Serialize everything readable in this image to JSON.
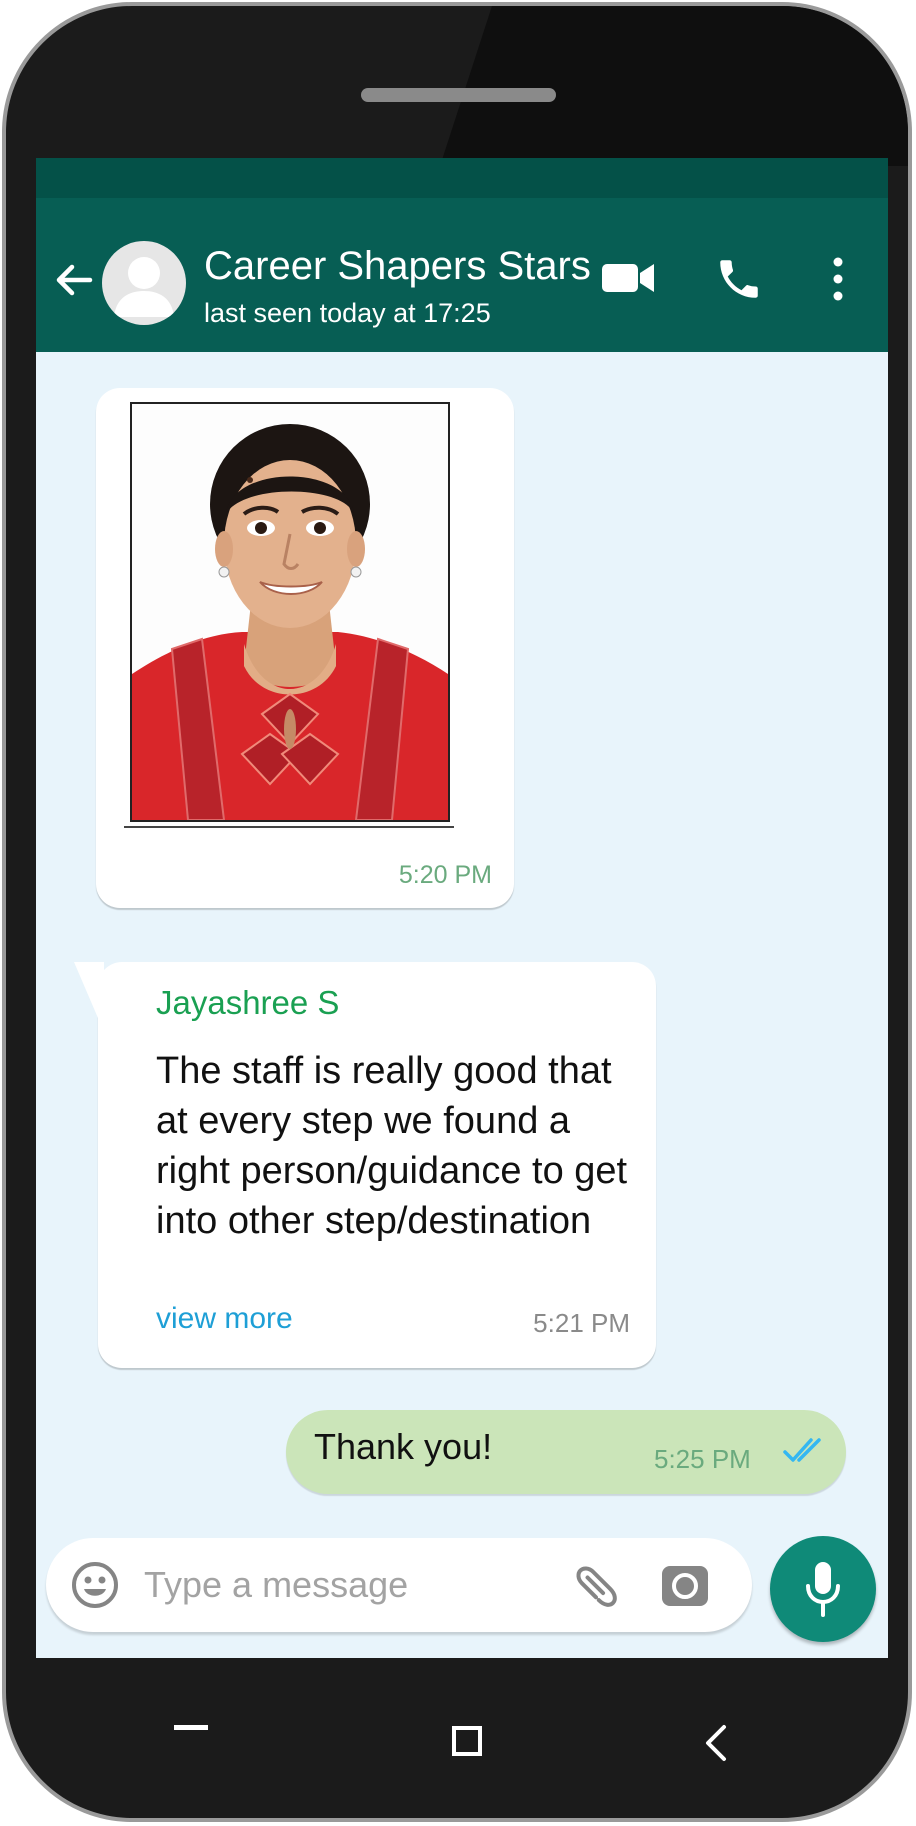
{
  "header": {
    "title": "Career Shapers Stars",
    "subtitle": "last seen today at 17:25"
  },
  "messages": [
    {
      "type": "image",
      "time": "5:20 PM"
    },
    {
      "type": "text",
      "sender": "Jayashree S",
      "text": "The staff is really good that at every step we found a right person/guidance to get into other step/destination",
      "link": "view more",
      "time": "5:21 PM"
    },
    {
      "type": "outgoing",
      "text": "Thank you!",
      "time": "5:25 PM",
      "status": "read"
    }
  ],
  "composer": {
    "placeholder": "Type a message"
  },
  "icons": [
    "back-arrow-icon",
    "avatar-icon",
    "video-call-icon",
    "phone-icon",
    "more-vert-icon",
    "emoji-icon",
    "attach-icon",
    "camera-icon",
    "mic-icon",
    "double-tick-icon"
  ],
  "colors": {
    "header": "#075e54",
    "status_bar": "#045148",
    "chat_background": "#e8f4fb",
    "outgoing_bubble": "#cbe5b9",
    "sender_name": "#1aa052",
    "link": "#1e9fd6",
    "mic_button": "#0f8a78",
    "read_ticks": "#34b7f1"
  }
}
